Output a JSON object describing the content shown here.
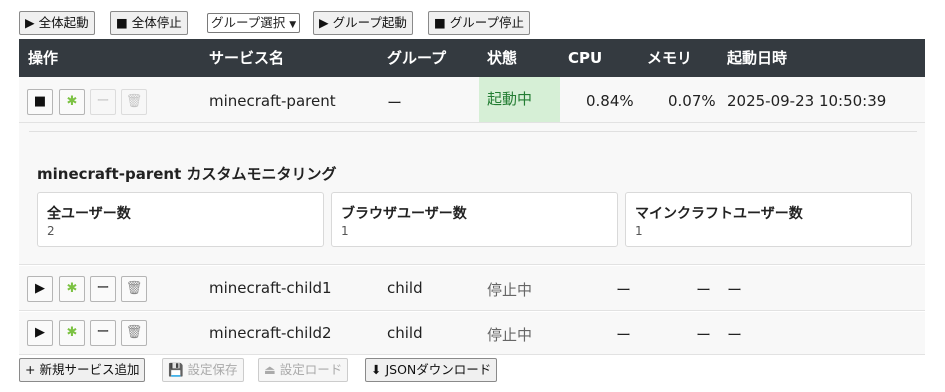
{
  "toolbar": {
    "start_all": "▶ 全体起動",
    "stop_all": "■ 全体停止",
    "group_select": "グループ選択",
    "group_start": "▶ グループ起動",
    "group_stop": "■ グループ停止"
  },
  "table": {
    "headers": [
      "操作",
      "サービス名",
      "グループ",
      "状態",
      "CPU",
      "メモリ",
      "起動日時"
    ],
    "rows": [
      {
        "name": "minecraft-parent",
        "group": "ー",
        "status": "起動中",
        "cpu": "0.84%",
        "memory": "0.07%",
        "started": "2025-09-23 10:50:39"
      },
      {
        "name": "minecraft-child1",
        "group": "child",
        "status": "停止中",
        "cpu": "ー",
        "memory": "ー",
        "started": "ー"
      },
      {
        "name": "minecraft-child2",
        "group": "child",
        "status": "停止中",
        "cpu": "ー",
        "memory": "ー",
        "started": "ー"
      }
    ]
  },
  "monitor": {
    "title": "minecraft-parent カスタムモニタリング",
    "cards": [
      {
        "label": "全ユーザー数",
        "value": "2"
      },
      {
        "label": "ブラウザユーザー数",
        "value": "1"
      },
      {
        "label": "マインクラフトユーザー数",
        "value": "1"
      }
    ]
  },
  "icons": {
    "stop": "■",
    "play": "▶",
    "plugin": "✱",
    "detach": "ー",
    "delete": "🗑"
  },
  "footer": {
    "add_service": "+ 新規サービス追加",
    "save_settings": "💾 設定保存",
    "load_settings": "⏏ 設定ロード",
    "download_json": "⬇ JSONダウンロード"
  },
  "colors": {
    "header_bg": "#343a40",
    "running_bg": "#d6efd6",
    "running_text": "#237d33",
    "plugin_icon": "#7cc243"
  }
}
